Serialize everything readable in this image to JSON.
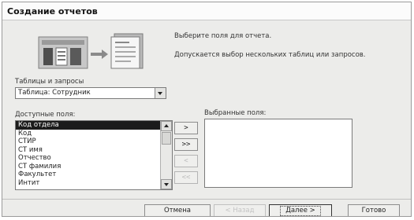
{
  "window": {
    "title": "Создание отчетов"
  },
  "intro": {
    "line1": "Выберите поля для отчета.",
    "line2": "Допускается выбор нескольких таблиц или запросов."
  },
  "source": {
    "label": "Таблицы и запросы",
    "selected": "Таблица: Сотрудник"
  },
  "available": {
    "label": "Доступные поля:",
    "items": [
      "Код отдела",
      "Код",
      "СТИР",
      "СТ имя",
      "Отчество",
      "СТ фамилия",
      "Факультет",
      "Интит"
    ],
    "selected_index": 0
  },
  "chosen": {
    "label": "Выбранные поля:",
    "items": []
  },
  "move_buttons": {
    "add_one": ">",
    "add_all": ">>",
    "remove_one": "<",
    "remove_all": "<<"
  },
  "buttons": {
    "cancel": "Отмена",
    "back": "< Назад",
    "next": "Далее >",
    "finish": "Готово"
  },
  "icons": {
    "illustration": "report-illustration-icon",
    "combo_arrow": "chevron-down-icon",
    "scroll_up": "scroll-up-icon",
    "scroll_down": "scroll-down-icon"
  },
  "colors": {
    "dialog_bg": "#ececea",
    "selection_bg": "#1b1b1b"
  }
}
